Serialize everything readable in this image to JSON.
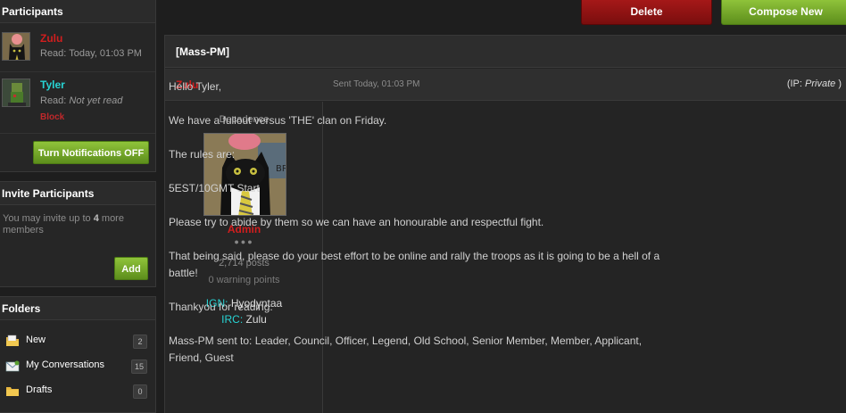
{
  "sidebar": {
    "participants": {
      "title": "Participants",
      "items": [
        {
          "name": "Zulu",
          "read_label": "Read:",
          "read_value": "Today, 01:03 PM",
          "color": "#d11e1e"
        },
        {
          "name": "Tyler",
          "read_label": "Read:",
          "read_value": "Not yet read",
          "block_label": "Block",
          "color": "#27d4d4"
        }
      ],
      "notifications_button": "Turn Notifications OFF"
    },
    "invite": {
      "title": "Invite Participants",
      "text_prefix": "You may invite up to",
      "count": "4",
      "text_suffix": "more members",
      "add_button": "Add"
    },
    "folders": {
      "title": "Folders",
      "items": [
        {
          "label": "New",
          "count": "2",
          "icon": "new-folder-icon"
        },
        {
          "label": "My Conversations",
          "count": "15",
          "icon": "envelope-icon"
        },
        {
          "label": "Drafts",
          "count": "0",
          "icon": "folder-icon"
        }
      ]
    }
  },
  "toolbar": {
    "delete_label": "Delete",
    "compose_label": "Compose New"
  },
  "conversation": {
    "title": "[Mass-PM]",
    "message": {
      "author": "Zulu",
      "sent": "Sent Today, 01:03 PM",
      "ip_prefix": "(IP:",
      "ip_value": "Private",
      "ip_suffix": ")",
      "user": {
        "title": "Decadence",
        "rank": "Admin",
        "posts": "2,714 posts",
        "warning": "0 warning points",
        "ign_label": "IGN:",
        "ign_value": "Hyodyntaa",
        "irc_label": "IRC:",
        "irc_value": "Zulu"
      },
      "body": [
        "Hello Tyler,",
        "We have a fullout versus 'THE' clan on Friday.",
        "The rules are:",
        "5EST/10GMT Start",
        "Please try to abide by them so we can have an honourable and respectful fight.",
        "That being said, please do your best effort to be online and rally the troops as it is going to be a hell of a battle!",
        "Thankyou for reading.",
        "Mass-PM sent to: Leader, Council, Officer, Legend, Old School, Senior Member, Member, Applicant, Friend, Guest"
      ]
    }
  },
  "colors": {
    "accent_green": "#7bb62d",
    "delete_red": "#a51818",
    "admin_red": "#d11e1e",
    "cyan": "#27d4d4"
  }
}
